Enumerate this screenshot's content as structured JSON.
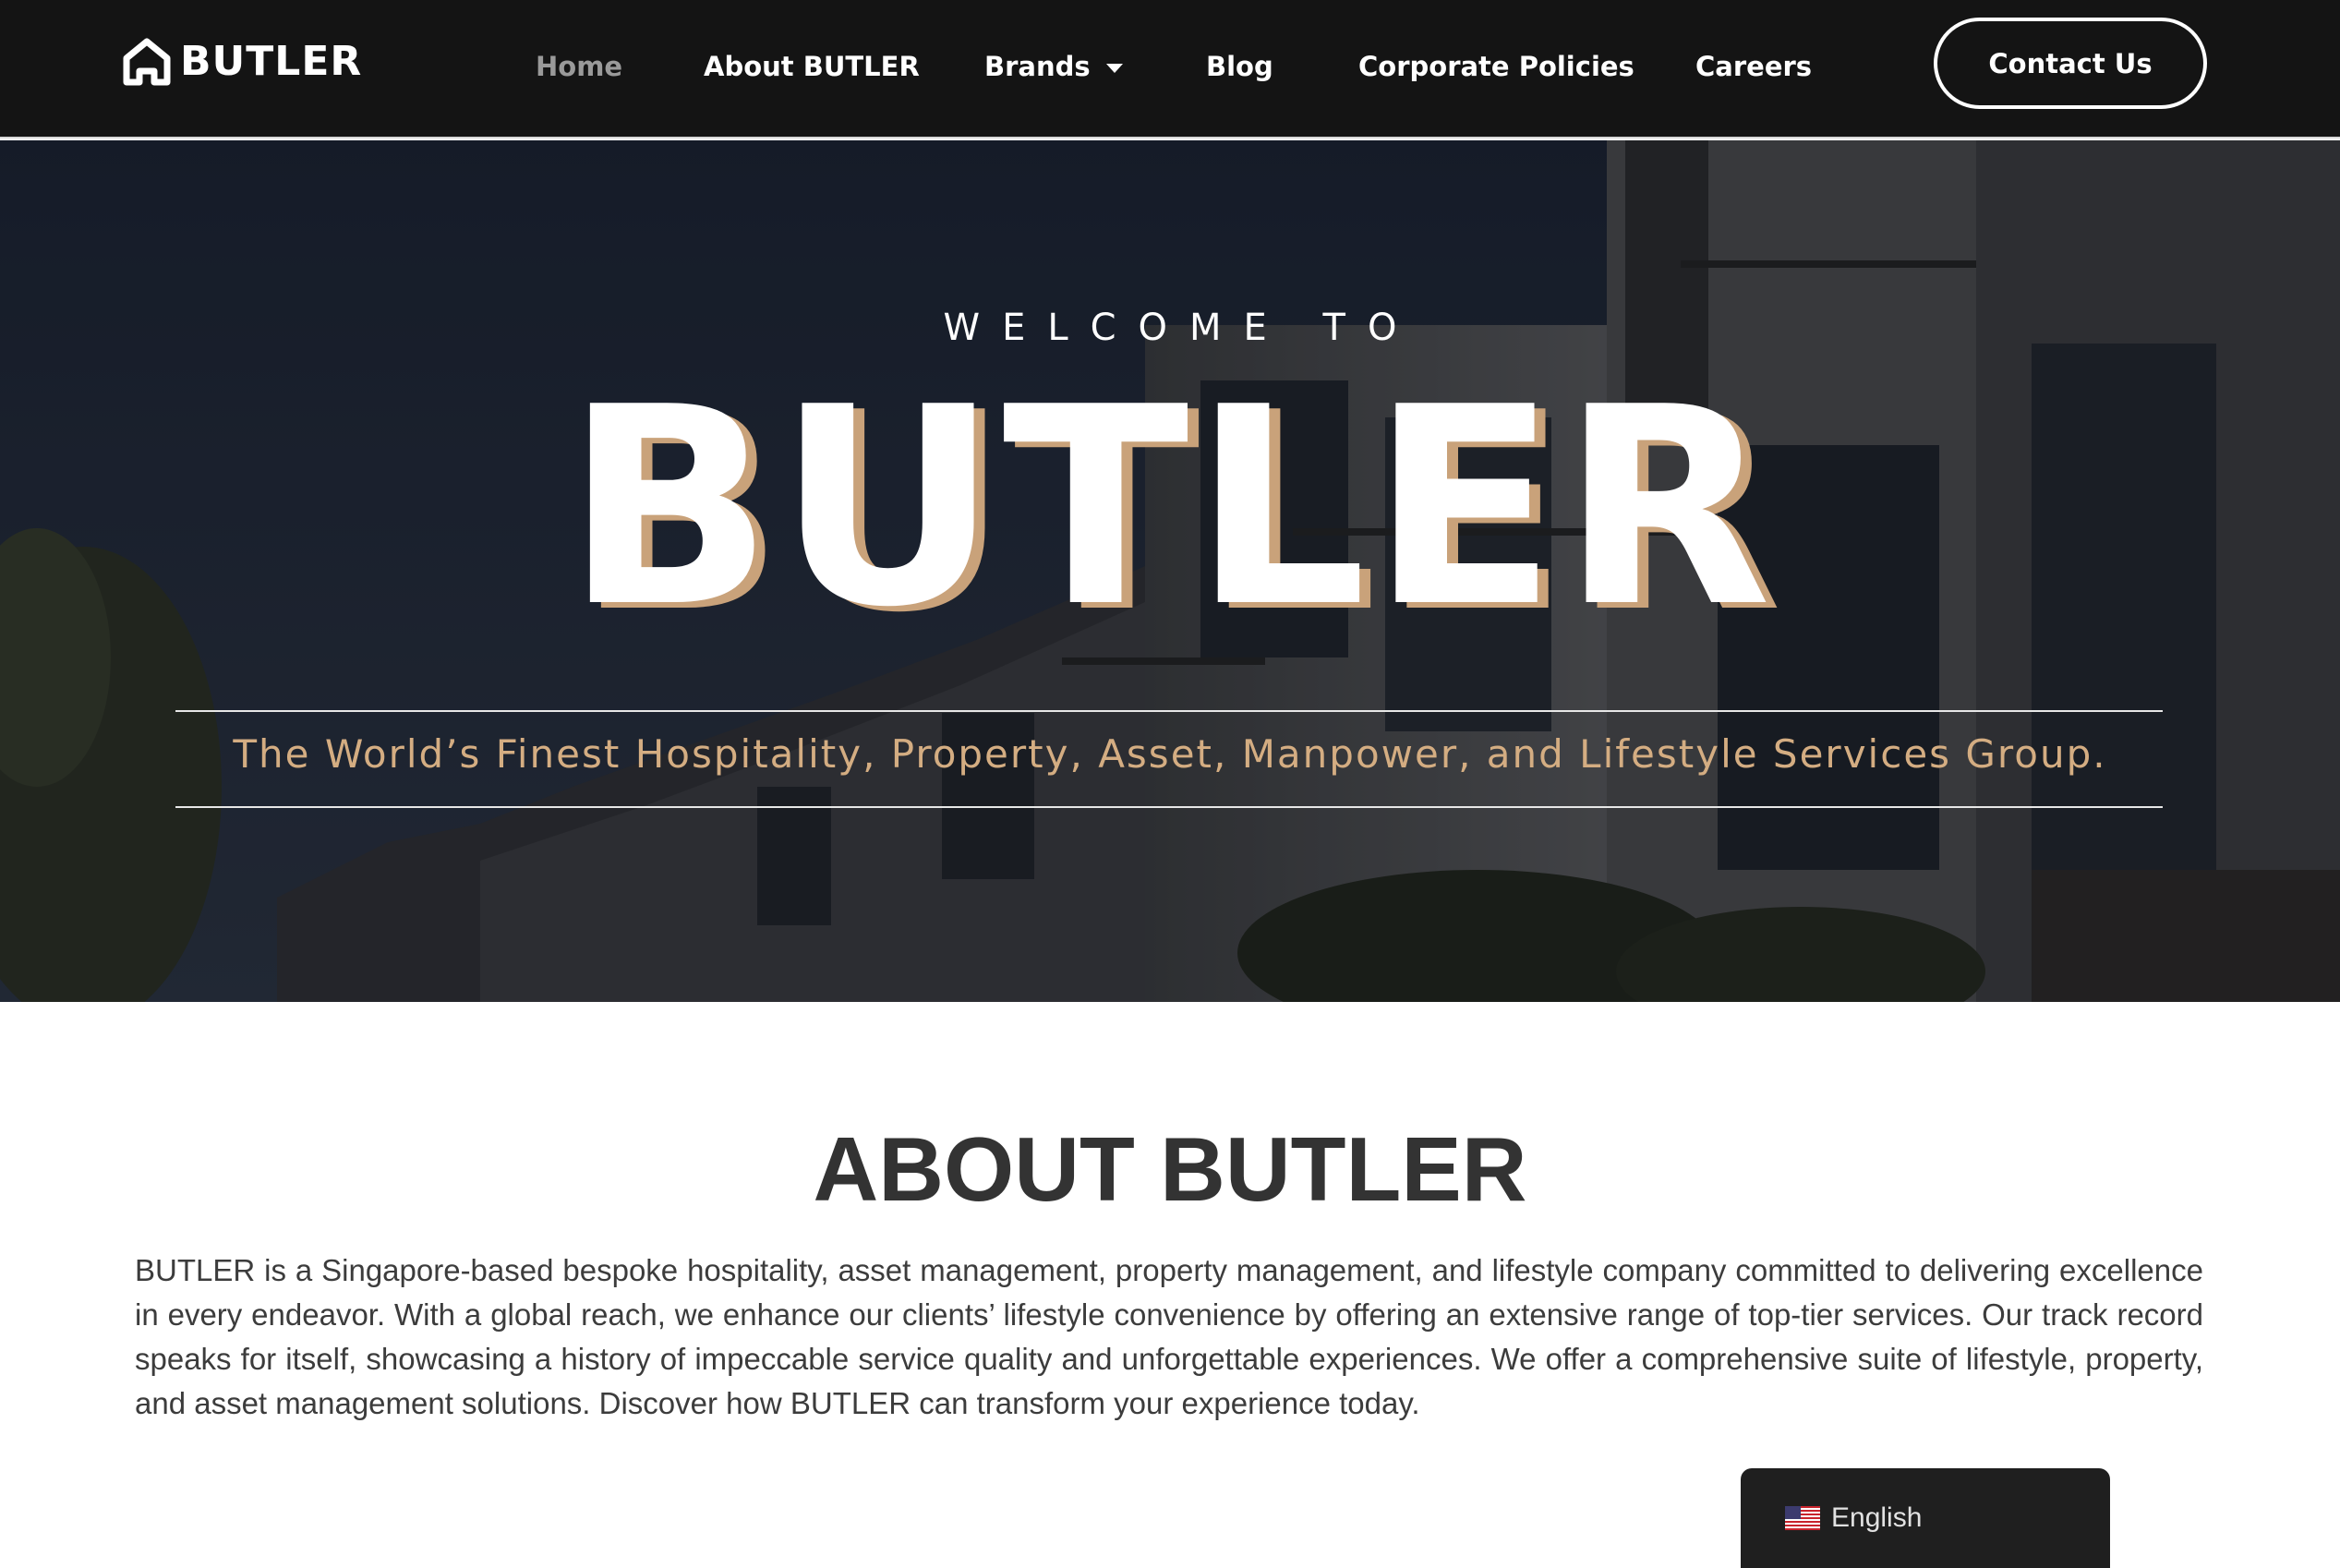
{
  "header": {
    "logo_text": "BUTLER",
    "nav": [
      {
        "label": "Home",
        "active": true
      },
      {
        "label": "About BUTLER",
        "active": false
      },
      {
        "label": "Brands",
        "active": false,
        "has_dropdown": true
      },
      {
        "label": "Blog",
        "active": false
      },
      {
        "label": "Corporate Policies",
        "active": false
      },
      {
        "label": "Careers",
        "active": false
      }
    ],
    "contact_label": "Contact Us"
  },
  "hero": {
    "welcome": "WELCOME TO",
    "title": "BUTLER",
    "tagline": "The World’s Finest Hospitality, Property, Asset, Manpower, and Lifestyle Services Group."
  },
  "about": {
    "title": "ABOUT BUTLER",
    "text": "BUTLER is a Singapore-based bespoke hospitality, asset management, property management, and lifestyle company committed to delivering excellence in every endeavor. With a global reach, we enhance our clients’ lifestyle convenience by offering an extensive range of top-tier services. Our track record speaks for itself, showcasing a history of impeccable service quality and unforgettable experiences. We offer a comprehensive suite of lifestyle, property, and asset management solutions. Discover how BUTLER can transform your experience today."
  },
  "language": {
    "label": "English",
    "flag_icon": "us-flag-icon"
  },
  "colors": {
    "header_bg": "#141414",
    "accent_gold": "#c9a27a",
    "tagline_gold": "#d4ad82",
    "active_nav": "#9a9a9a"
  }
}
